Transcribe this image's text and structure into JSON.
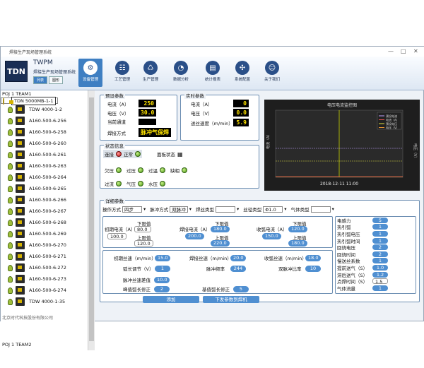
{
  "window": {
    "title": "焊接生产现场管理系统"
  },
  "ribbon": {
    "logo": "TDN",
    "app_name": "TWPM",
    "app_subtitle": "焊接生产现场管理系统",
    "view_buttons": [
      "列表",
      "图形"
    ],
    "nav": [
      "设备管理",
      "工艺管理",
      "生产管理",
      "数据分析",
      "统计报表",
      "系统配置",
      "关于我们"
    ]
  },
  "tree": {
    "group1": "POJ 1 TEAM1",
    "group2": "POJ 1 TEAM2",
    "devices": [
      "TDN 5000MB-1-1",
      "TDW 4000-1-2",
      "A160-500-6-256",
      "A160-500-6-258",
      "A160-500-6-260",
      "A160-500-6-261",
      "A160-500-6-263",
      "A160-500-6-264",
      "A160-500-6-265",
      "A160-500-6-266",
      "A160-500-6-267",
      "A160-500-6-268",
      "A160-500-6-269",
      "A160-500-6-270",
      "A160-500-6-271",
      "A160-500-6-272",
      "A160-500-6-273",
      "A160-500-6-274",
      "TDW 4000-1-35"
    ]
  },
  "preset": {
    "title": "预设参数",
    "current_label": "电流（A）",
    "current": "250",
    "voltage_label": "电压（V）",
    "voltage": "30.0",
    "channel_label": "当前通道",
    "channel": "",
    "mode_label": "焊接方式",
    "mode": "脉冲气保焊"
  },
  "realtime": {
    "title": "实时参数",
    "current_label": "电流（A）",
    "current": "0",
    "voltage_label": "电压（V）",
    "voltage": "0.0",
    "wire_label": "送丝速度（m/min）",
    "wire": "5.9"
  },
  "chart": {
    "title": "电压电流监控图",
    "legend": [
      "预设电流",
      "电流（A）",
      "预设电压",
      "电压（V）"
    ],
    "legend_colors": [
      "#c0a0ff",
      "#e05050",
      "#e0e040",
      "#e09030"
    ],
    "ylabel_left": "电流（A）",
    "ylabel_right": "电压（V）",
    "timestamp": "2018-12-11 11:00"
  },
  "status": {
    "title": "状态信息",
    "connected": "连接",
    "normal": "正常",
    "panel_state": "面板状态",
    "items": [
      "欠压",
      "过压",
      "过温",
      "缺相",
      "过流",
      "气压",
      "水压"
    ]
  },
  "detail": {
    "title": "详细参数",
    "selects": [
      {
        "label": "操作方式",
        "value": "四步"
      },
      {
        "label": "脉冲方式",
        "value": "双脉冲"
      },
      {
        "label": "焊丝类型",
        "value": ""
      },
      {
        "label": "丝径类型",
        "value": "Φ1.0"
      },
      {
        "label": "气体类型",
        "value": ""
      }
    ],
    "initial": {
      "label": "初期电流（A）",
      "value": "100.0",
      "lower_label": "下限值",
      "lower": "80.0",
      "upper_label": "上限值",
      "upper": "120.0"
    },
    "welding": {
      "label": "焊接电流（A）",
      "value": "200.0",
      "lower_label": "下限值",
      "lower": "180.0",
      "upper_label": "上限值",
      "upper": "220.0"
    },
    "crater": {
      "label": "收弧电流（A）",
      "value": "150.0",
      "lower_label": "下限值",
      "lower": "120.0",
      "upper_label": "上限值",
      "upper": "180.0"
    },
    "wires": [
      {
        "label": "初期丝速（m/min）",
        "value": "15.0"
      },
      {
        "label": "焊接丝速（m/min）",
        "value": "20.0"
      },
      {
        "label": "收弧丝速（m/min）",
        "value": "18.0"
      }
    ],
    "arc_label": "弧长调节（V）",
    "arc": "1",
    "pulse_freq_label": "脉冲频率",
    "pulse_freq": "244",
    "dual_ratio_label": "双脉冲比率",
    "dual_ratio": "10",
    "pulse_wire_label": "脉冲丝速差值",
    "pulse_wire": "10.0",
    "peak_label": "峰值弧长修正",
    "peak": "2",
    "base_label": "基值弧长修正",
    "base": "5",
    "right": [
      {
        "label": "电感力",
        "value": "5"
      },
      {
        "label": "热引弧",
        "value": "1"
      },
      {
        "label": "热引弧电压",
        "value": "1"
      },
      {
        "label": "热引弧时间",
        "value": "1"
      },
      {
        "label": "回烧电压",
        "value": "2"
      },
      {
        "label": "回烧时间",
        "value": "2"
      },
      {
        "label": "慢送丝系数",
        "value": "1"
      },
      {
        "label": "提前送气（S）",
        "value": "1.0"
      },
      {
        "label": "滞后送气（S）",
        "value": "1.2"
      },
      {
        "label": "点焊时间（S）",
        "value": "1.5"
      },
      {
        "label": "气体流量",
        "value": "1"
      }
    ],
    "add_button": "添加",
    "send_button": "下发参数到焊机"
  },
  "footer": "北京时代科技股份有限公司"
}
